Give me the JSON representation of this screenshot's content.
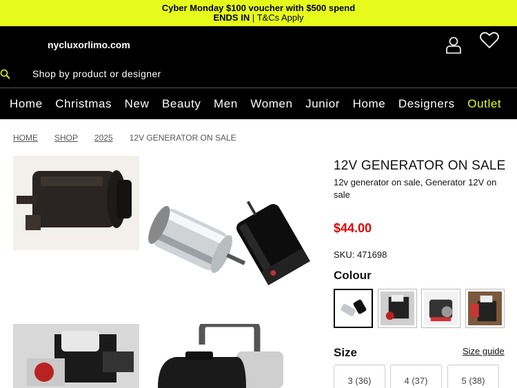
{
  "promo": {
    "line1": "Cyber Monday $100 voucher with $500 spend",
    "ends": "ENDS IN",
    "terms": " | T&Cs Apply"
  },
  "header": {
    "logo": "nycluxorlimo.com",
    "search_placeholder": "Shop by product or designer"
  },
  "nav": {
    "items": [
      "Home",
      "Christmas",
      "New",
      "Beauty",
      "Men",
      "Women",
      "Junior",
      "Home",
      "Designers"
    ],
    "outlet": "Outlet"
  },
  "breadcrumb": [
    "HOME",
    "SHOP",
    "2025",
    "12V GENERATOR ON SALE"
  ],
  "product": {
    "title": "12V GENERATOR ON SALE",
    "subtitle": "12v generator on sale, Generator 12V on sale",
    "price": "$44.00",
    "sku": "SKU: 471698",
    "colour_heading": "Colour",
    "size_heading": "Size",
    "size_guide": "Size guide",
    "sizes": [
      "3 (36)",
      "4 (37)",
      "5 (38)"
    ]
  },
  "colors": {
    "promo": "#e6fb1c",
    "price": "#e60000",
    "header": "#000000"
  }
}
